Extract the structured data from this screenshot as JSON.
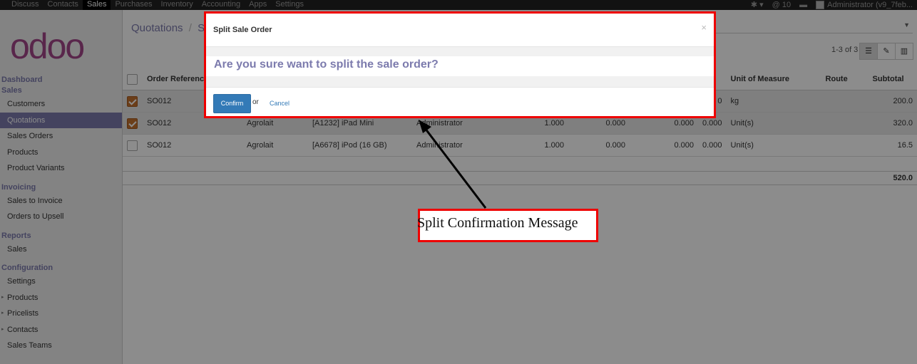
{
  "topbar": {
    "menu": [
      "Discuss",
      "Contacts",
      "Sales",
      "Purchases",
      "Inventory",
      "Accounting",
      "Apps",
      "Settings"
    ],
    "active_index": 2,
    "messages": "10",
    "user": "Administrator (v9_7feb..."
  },
  "logo_text": "odoo",
  "sidebar": {
    "sections": [
      {
        "head": "Dashboard",
        "items": []
      },
      {
        "head": "Sales",
        "items": [
          {
            "label": "Customers"
          },
          {
            "label": "Quotations",
            "active": true
          },
          {
            "label": "Sales Orders"
          },
          {
            "label": "Products"
          },
          {
            "label": "Product Variants"
          }
        ]
      },
      {
        "head": "Invoicing",
        "items": [
          {
            "label": "Sales to Invoice"
          },
          {
            "label": "Orders to Upsell"
          }
        ]
      },
      {
        "head": "Reports",
        "items": [
          {
            "label": "Sales"
          }
        ]
      },
      {
        "head": "Configuration",
        "items": [
          {
            "label": "Settings"
          },
          {
            "label": "Products",
            "caret": true
          },
          {
            "label": "Pricelists",
            "caret": true
          },
          {
            "label": "Contacts",
            "caret": true
          },
          {
            "label": "Sales Teams"
          }
        ]
      }
    ]
  },
  "breadcrumb": {
    "root": "Quotations",
    "sep": "/",
    "current": "SO"
  },
  "pager": "1-3 of 3",
  "table": {
    "columns": [
      "Order Reference",
      "",
      "",
      "",
      "",
      "",
      "",
      "",
      "Unit of Measure",
      "Route",
      "Subtotal"
    ],
    "rows": [
      {
        "checked": true,
        "ref": "SO012",
        "customer": "",
        "product": "",
        "user": "",
        "qty": "",
        "c1": "",
        "c2": "",
        "c3": "0",
        "uom": "kg",
        "route": "",
        "subtotal": "200.0"
      },
      {
        "checked": true,
        "ref": "SO012",
        "customer": "Agrolait",
        "product": "[A1232] iPad Mini",
        "user": "Administrator",
        "qty": "1.000",
        "c1": "0.000",
        "c2": "0.000",
        "c3": "0.000",
        "uom": "Unit(s)",
        "route": "",
        "subtotal": "320.0"
      },
      {
        "checked": false,
        "ref": "SO012",
        "customer": "Agrolait",
        "product": "[A6678] iPod (16 GB)",
        "user": "Administrator",
        "qty": "1.000",
        "c1": "0.000",
        "c2": "0.000",
        "c3": "0.000",
        "uom": "Unit(s)",
        "route": "",
        "subtotal": "16.5"
      }
    ],
    "total": "520.0"
  },
  "dialog": {
    "title": "Split Sale Order",
    "close": "×",
    "message": "Are you sure want to split the sale order?",
    "confirm_label": "Confirm",
    "or_text": "or",
    "cancel_label": "Cancel"
  },
  "annotation": {
    "text": "Split Confirmation Message",
    "color": "#ee0000"
  },
  "colors": {
    "brand": "#7c7bad",
    "primary": "#337ab7",
    "checkbox": "#c4722f"
  }
}
